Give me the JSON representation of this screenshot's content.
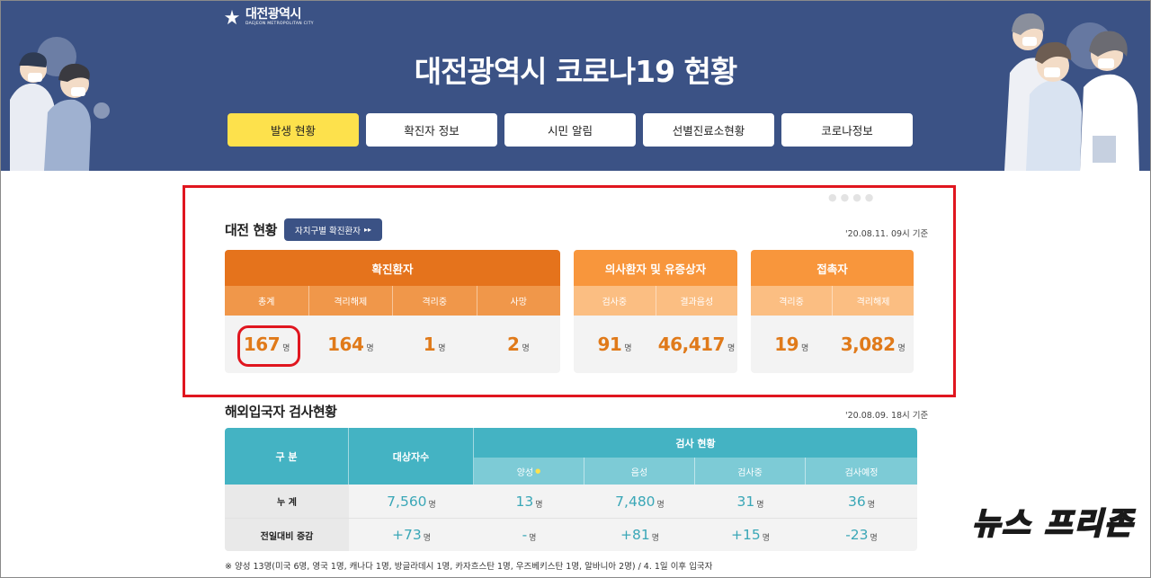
{
  "header": {
    "logo_kr": "대전광역시",
    "logo_en": "DAEJEON METROPOLITAN CITY",
    "title": "대전광역시 코로나19 현황",
    "nav": [
      {
        "label": "발생 현황",
        "active": true
      },
      {
        "label": "확진자 정보",
        "active": false
      },
      {
        "label": "시민 알림",
        "active": false
      },
      {
        "label": "선별진료소현황",
        "active": false
      },
      {
        "label": "코로나정보",
        "active": false
      }
    ]
  },
  "status": {
    "title": "대전 현황",
    "region_button": "자치구별 확진환자",
    "region_button_icon": "double-chevron-right-icon",
    "basis": "'20.08.11. 09시 기준",
    "unit": "명",
    "confirmed": {
      "head": "확진환자",
      "cols": [
        {
          "label": "총계",
          "value": "167"
        },
        {
          "label": "격리해제",
          "value": "164"
        },
        {
          "label": "격리중",
          "value": "1"
        },
        {
          "label": "사망",
          "value": "2"
        }
      ]
    },
    "suspected": {
      "head": "의사환자 및 유증상자",
      "cols": [
        {
          "label": "검사중",
          "value": "91"
        },
        {
          "label": "결과음성",
          "value": "46,417"
        }
      ]
    },
    "contacts": {
      "head": "접촉자",
      "cols": [
        {
          "label": "격리중",
          "value": "19"
        },
        {
          "label": "격리해제",
          "value": "3,082"
        }
      ]
    }
  },
  "overseas": {
    "title": "해외입국자 검사현황",
    "basis": "'20.08.09. 18시 기준",
    "unit": "명",
    "header": {
      "category": "구 분",
      "target": "대상자수",
      "test_status": "검사 현황",
      "sub": [
        "양성",
        "음성",
        "검사중",
        "검사예정"
      ]
    },
    "rows": [
      {
        "label": "누 계",
        "values": [
          "7,560",
          "13",
          "7,480",
          "31",
          "36"
        ]
      },
      {
        "label": "전일대비 증감",
        "values": [
          "+73",
          "-",
          "+81",
          "+15",
          "-23"
        ]
      }
    ],
    "note": "※ 양성 13명(미국 6명, 영국 1명, 캐나다 1명, 방글라데시 1명, 카자흐스탄 1명, 우즈베키스탄 1명, 알바니아 2명) / 4. 1일 이후 입국자"
  },
  "watermark": "뉴스 프리존",
  "colors": {
    "header_bg": "#3b5285",
    "nav_active": "#fde14c",
    "confirmed_head": "#e5731c",
    "orange_head": "#f8963c",
    "teal_head": "#44b3c3",
    "highlight_red": "#e0161f"
  }
}
